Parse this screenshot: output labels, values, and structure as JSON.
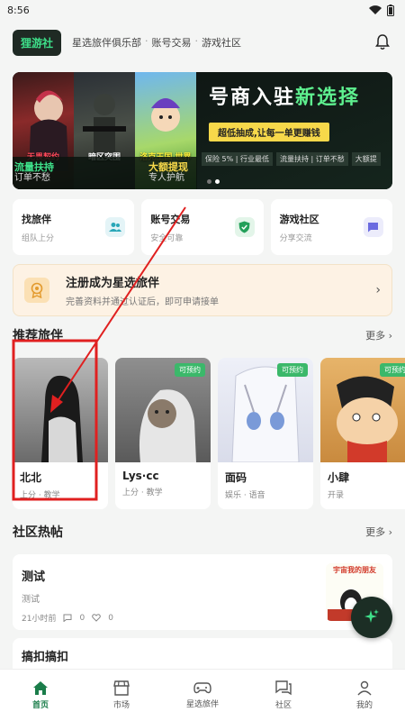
{
  "status": {
    "time": "8:56"
  },
  "header": {
    "brand": "狸游社",
    "nav": [
      "星选旅伴俱乐部",
      "账号交易",
      "游戏社区"
    ],
    "separator": "·"
  },
  "banner": {
    "games": [
      "无畏契约",
      "暗区突围",
      "洛克王国 世界"
    ],
    "left_band": {
      "a_title": "流量扶持",
      "a_sub": "订单不愁",
      "b_title": "大额提现",
      "b_sub": "专人护航"
    },
    "promo_title_white": "号商入驻",
    "promo_title_green": "新选择",
    "promo_badge": "超低抽成,让每一单更赚钱",
    "promo_chips": [
      "保险 5% | 行业最低",
      "流量扶持 | 订单不愁",
      "大额提"
    ]
  },
  "services": [
    {
      "title": "找旅伴",
      "sub": "组队上分",
      "icon": "people-icon",
      "color": "#29a7b8",
      "bg": "#e4f4f7"
    },
    {
      "title": "账号交易",
      "sub": "安全可靠",
      "icon": "shield-check-icon",
      "color": "#24a05a",
      "bg": "#e3f5e9"
    },
    {
      "title": "游戏社区",
      "sub": "分享交流",
      "icon": "chat-icon",
      "color": "#6b6be0",
      "bg": "#ececfb"
    }
  ],
  "register": {
    "title": "注册成为星选旅伴",
    "sub": "完善资料并通过认证后，即可申请接单",
    "arrow": "›"
  },
  "recommend": {
    "title": "推荐旅伴",
    "more": "更多 ›",
    "cards": [
      {
        "name": "北北",
        "tags": "上分 · 教学",
        "badge": ""
      },
      {
        "name": "Lys·cc",
        "tags": "上分 · 教学",
        "badge": "可预约"
      },
      {
        "name": "面码",
        "tags": "娱乐 · 语音",
        "badge": "可预约"
      },
      {
        "name": "小肆",
        "tags": "开录",
        "badge": "可预约"
      }
    ]
  },
  "community": {
    "title": "社区热帖",
    "more": "更多 ›",
    "post": {
      "title": "测试",
      "sub": "测试",
      "time": "21小时前",
      "comments": "0",
      "likes": "0",
      "thumb_text": "宇宙我的朋友"
    },
    "post2_title": "搞扣搞扣"
  },
  "tabs": [
    {
      "label": "首页",
      "icon": "home-icon",
      "active": true
    },
    {
      "label": "市场",
      "icon": "store-icon",
      "active": false
    },
    {
      "label": "星选旅伴",
      "icon": "gamepad-icon",
      "active": false
    },
    {
      "label": "社区",
      "icon": "community-icon",
      "active": false
    },
    {
      "label": "我的",
      "icon": "profile-icon",
      "active": false
    }
  ],
  "colors": {
    "accent": "#1a7d4a",
    "brand_bg": "#1f2a24",
    "annotation": "#e02020"
  }
}
